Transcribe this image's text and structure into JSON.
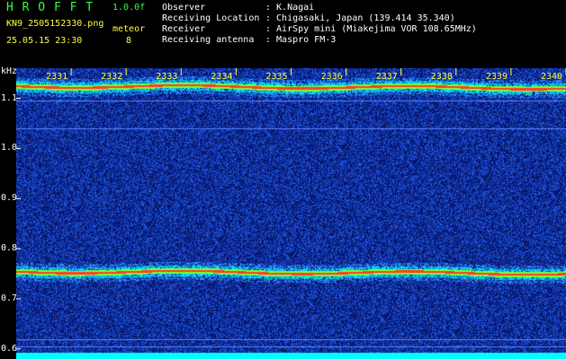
{
  "header": {
    "logo": "H R O F F T",
    "version": "1.0.0f",
    "filename": "KN9_2505152330.png",
    "datetime": "25.05.15 23:30",
    "meteor_label": "meteor",
    "meteor_count": "8"
  },
  "info": [
    {
      "label": "Observer",
      "value": ": K.Nagai"
    },
    {
      "label": "Receiving Location",
      "value": ": Chigasaki, Japan (139.414 35.340)"
    },
    {
      "label": "Receiver",
      "value": ": AirSpy mini (Miakejima VOR 108.65MHz)"
    },
    {
      "label": "Receiving antenna",
      "value": ": Maspro FM-3"
    }
  ],
  "chart_data": {
    "type": "heatmap",
    "ylabel": "kHz",
    "y_ticks": [
      "1.1",
      "1.0",
      "0.9",
      "0.8",
      "0.7",
      "0.6"
    ],
    "x_ticks": [
      "2331",
      "2332",
      "2333",
      "2334",
      "2335",
      "2336",
      "2337",
      "2338",
      "2339",
      "2340"
    ],
    "ylim": [
      0.58,
      1.16
    ],
    "xlim": [
      2330,
      2340
    ],
    "signals": [
      {
        "freq": 1.125,
        "strength": "strong"
      },
      {
        "freq": 0.755,
        "strength": "strong"
      },
      {
        "freq": 1.095,
        "strength": "weak"
      },
      {
        "freq": 1.04,
        "strength": "weak"
      },
      {
        "freq": 0.62,
        "strength": "weak"
      },
      {
        "freq": 0.605,
        "strength": "weak"
      }
    ],
    "colors": {
      "background": "#0a1a6b",
      "noise": "#2f6cff",
      "strong": "#ff3b2f",
      "mid": "#36ff3e",
      "edge": "#00ffff"
    }
  }
}
